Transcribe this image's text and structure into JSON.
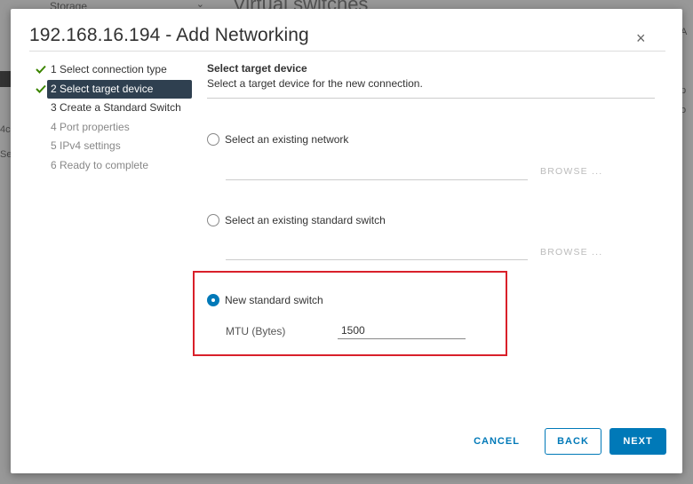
{
  "background": {
    "storage_label": "Storage",
    "page_title": "Virtual switches",
    "left_text_1": "4c",
    "left_text_2": "Se",
    "right_text_1": "A",
    "right_text_2": "p",
    "right_text_3": "o"
  },
  "dialog": {
    "title": "192.168.16.194 - Add Networking",
    "close_glyph": "×"
  },
  "steps": [
    {
      "label": "1 Select connection type",
      "state": "done"
    },
    {
      "label": "2 Select target device",
      "state": "active"
    },
    {
      "label": "3 Create a Standard Switch",
      "state": "current"
    },
    {
      "label": "4 Port properties",
      "state": "pending"
    },
    {
      "label": "5 IPv4 settings",
      "state": "pending"
    },
    {
      "label": "6 Ready to complete",
      "state": "pending"
    }
  ],
  "main": {
    "section_title": "Select target device",
    "section_desc": "Select a target device for the new connection.",
    "options": [
      {
        "label": "Select an existing network",
        "checked": false,
        "browse_label": "BROWSE ..."
      },
      {
        "label": "Select an existing standard switch",
        "checked": false,
        "browse_label": "BROWSE ..."
      },
      {
        "label": "New standard switch",
        "checked": true
      }
    ],
    "mtu": {
      "label": "MTU (Bytes)",
      "value": "1500"
    }
  },
  "footer": {
    "cancel_label": "CANCEL",
    "back_label": "BACK",
    "next_label": "NEXT"
  },
  "colors": {
    "accent": "#0079b8",
    "active_step_bg": "#2f4050",
    "highlight_border": "#d9202a",
    "check_green": "#3c8500"
  }
}
